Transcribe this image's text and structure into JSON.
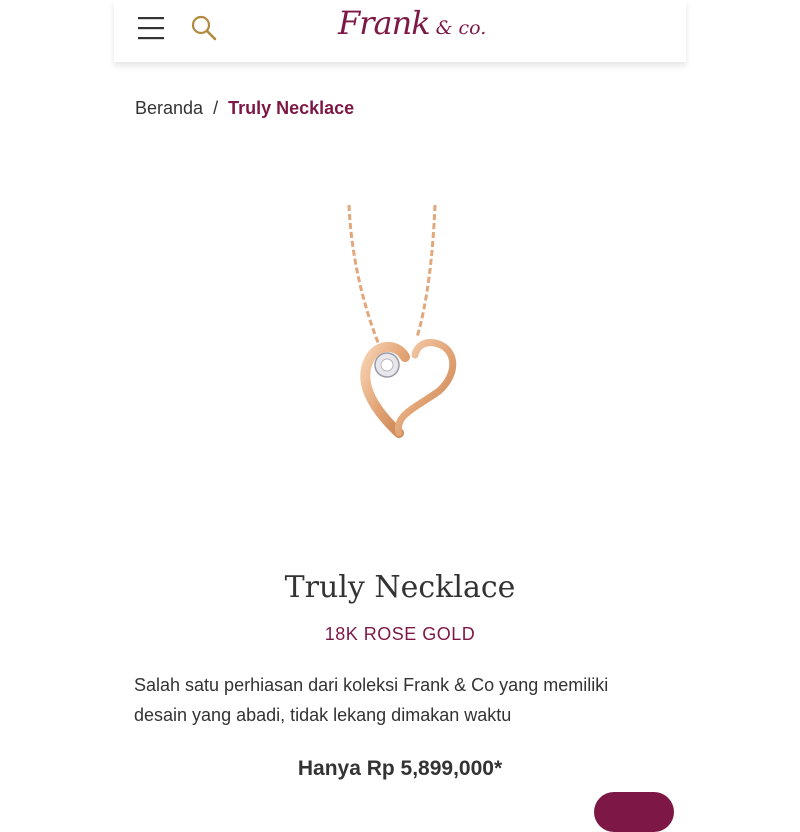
{
  "header": {
    "logo_main": "Frank",
    "logo_sub": "& co.",
    "menu_icon": "hamburger-menu-icon",
    "search_icon": "search-icon"
  },
  "breadcrumb": {
    "home": "Beranda",
    "separator": "/",
    "current": "Truly Necklace"
  },
  "product": {
    "name": "Truly Necklace",
    "material": "18K ROSE GOLD",
    "description": "Salah satu perhiasan dari koleksi Frank & Co yang memiliki desain yang abadi, tidak lekang dimakan waktu",
    "price": "Hanya Rp 5,899,000*",
    "image_icon": "heart-pendant-necklace-image"
  },
  "colors": {
    "brand": "#7d1846",
    "text": "#333333",
    "search_icon": "#b08a3e",
    "rose_gold": "#e2a77a"
  }
}
